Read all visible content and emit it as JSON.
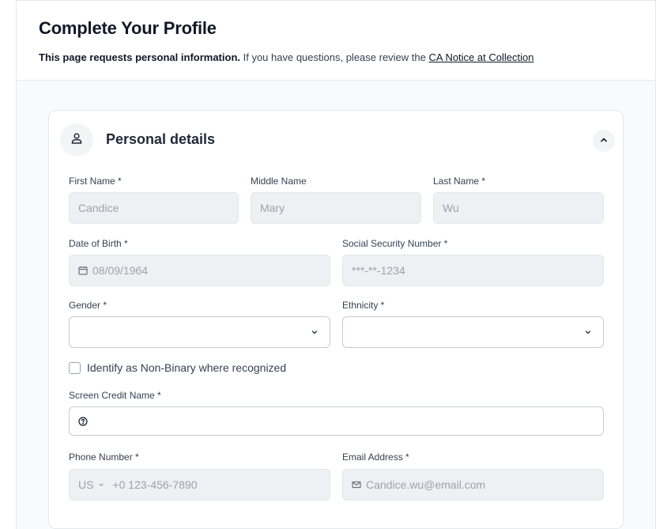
{
  "header": {
    "title": "Complete Your Profile",
    "notice_bold": "This page requests personal information.",
    "notice_text": " If you have questions, please review the ",
    "notice_link": "CA Notice at Collection"
  },
  "section": {
    "title": "Personal details",
    "icon": "user-icon",
    "collapse_icon": "chevron-up-icon"
  },
  "fields": {
    "first_name": {
      "label": "First Name *",
      "value": "Candice"
    },
    "middle_name": {
      "label": "Middle Name",
      "value": "Mary"
    },
    "last_name": {
      "label": "Last Name *",
      "value": "Wu"
    },
    "dob": {
      "label": "Date of Birth *",
      "value": "08/09/1964",
      "icon": "calendar-icon"
    },
    "ssn": {
      "label": "Social Security Number *",
      "value": "***-**-1234"
    },
    "gender": {
      "label": "Gender *",
      "value": ""
    },
    "ethnicity": {
      "label": "Ethnicity *",
      "value": ""
    },
    "non_binary": {
      "label": "Identify as Non-Binary where recognized",
      "checked": false
    },
    "screen_credit_name": {
      "label": "Screen Credit Name *",
      "value": "",
      "icon": "help-circle-icon"
    },
    "phone": {
      "label": "Phone Number *",
      "country": "US",
      "placeholder": "+0 123-456-7890"
    },
    "email": {
      "label": "Email Address *",
      "value": "Candice.wu@email.com",
      "icon": "mail-icon"
    }
  }
}
